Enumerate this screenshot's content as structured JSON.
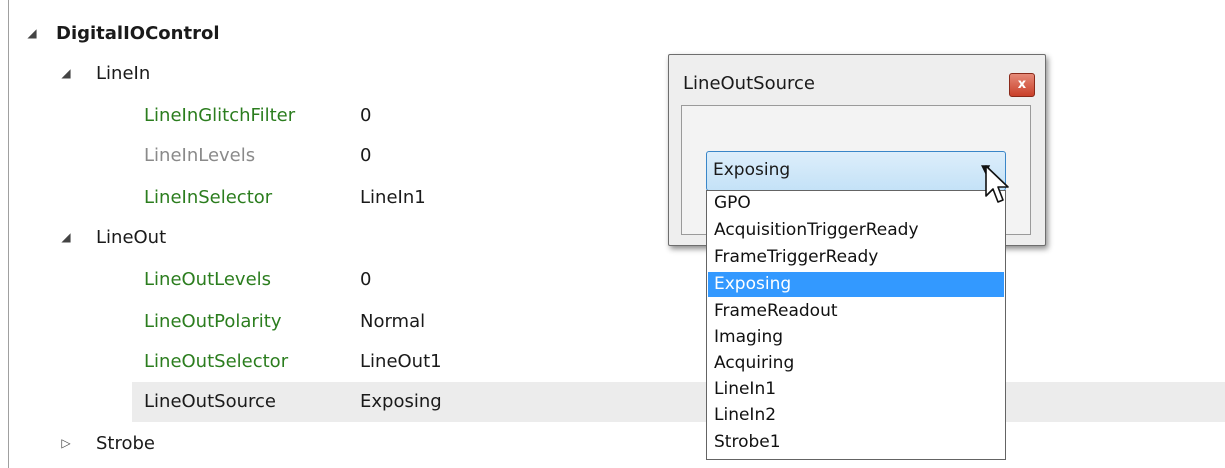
{
  "tree": {
    "root": {
      "label": "DigitalIOControl",
      "expanded": true
    },
    "linein": {
      "label": "LineIn",
      "items": [
        {
          "name": "LineInGlitchFilter",
          "value": "0"
        },
        {
          "name": "LineInLevels",
          "value": "0"
        },
        {
          "name": "LineInSelector",
          "value": "LineIn1"
        }
      ]
    },
    "lineout": {
      "label": "LineOut",
      "items": [
        {
          "name": "LineOutLevels",
          "value": "0"
        },
        {
          "name": "LineOutPolarity",
          "value": "Normal"
        },
        {
          "name": "LineOutSelector",
          "value": "LineOut1"
        },
        {
          "name": "LineOutSource",
          "value": "Exposing"
        }
      ]
    },
    "strobe": {
      "label": "Strobe"
    }
  },
  "dialog": {
    "title": "LineOutSource",
    "close_glyph": "x",
    "combo_value": "Exposing",
    "options": [
      "GPO",
      "AcquisitionTriggerReady",
      "FrameTriggerReady",
      "Exposing",
      "FrameReadout",
      "Imaging",
      "Acquiring",
      "LineIn1",
      "LineIn2",
      "Strobe1"
    ],
    "selected_option": "Exposing"
  },
  "icons": {
    "expanded": "triangle-down-right-icon",
    "collapsed": "triangle-right-outline-icon",
    "dropdown": "down-arrow-icon",
    "cursor": "mouse-pointer-icon"
  },
  "colors": {
    "editable_name": "#2b7d1e",
    "readonly_name": "#8a8a8a",
    "selection": "#3399ff"
  }
}
